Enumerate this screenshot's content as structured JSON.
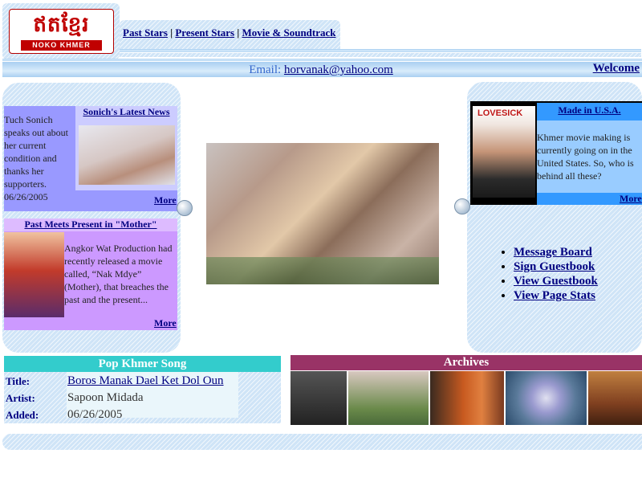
{
  "logo": {
    "khmer": "ឥតខ្មែរ",
    "sub": "NOKO KHMER"
  },
  "nav": {
    "links": [
      "Past Stars",
      "Present Stars",
      "Movie & Soundtrack"
    ],
    "separator": "|"
  },
  "header": {
    "email_label": "Email:",
    "email": "horvanak@yahoo.com",
    "welcome": "Welcome"
  },
  "left": {
    "news1": {
      "title": "Sonich's Latest News",
      "text": "Tuch Sonich speaks out about her current condition and thanks her supporters.",
      "date": "06/26/2005",
      "more": "More"
    },
    "news2": {
      "title": "Past Meets Present in \"Mother\"",
      "text": "Angkor Wat Production had recently released a movie called, “Nak Mdye” (Mother), that breaches the past and the present...",
      "more": "More"
    }
  },
  "right": {
    "title": "Made in U.S.A.",
    "poster": "LOVESICK",
    "text": "Khmer movie making is currently going on in the United States. So, who is behind all these?",
    "more": "More",
    "links": [
      "Message Board",
      "Sign Guestbook",
      "View Guestbook",
      "View Page Stats"
    ]
  },
  "song": {
    "header": "Pop Khmer Song",
    "title_label": "Title:",
    "title": "Boros Manak Dael Ket Dol Oun",
    "artist_label": "Artist:",
    "artist": "Sapoon Midada",
    "added_label": "Added:",
    "added": "06/26/2005"
  },
  "archives": {
    "header": "Archives",
    "thumbs": [
      {
        "color": "#3a3a3a"
      },
      {
        "color": "#6a8a4a"
      },
      {
        "color": "#c85a20"
      },
      {
        "color": "#6a7a9a"
      },
      {
        "color": "#a06a40"
      }
    ]
  }
}
